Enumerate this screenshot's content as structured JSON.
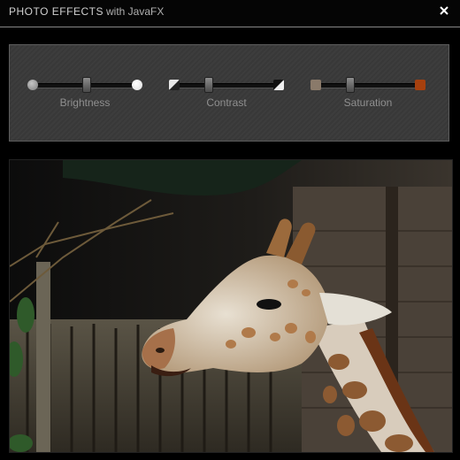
{
  "window": {
    "title": "PHOTO EFFECTS",
    "subtitle": "with JavaFX",
    "close_icon": "close-icon"
  },
  "controls": {
    "sliders": [
      {
        "label": "Brightness",
        "value": 0.5,
        "left_icon": "dark-dot-icon",
        "right_icon": "bright-dot-icon"
      },
      {
        "label": "Contrast",
        "value": 0.3,
        "left_icon": "low-contrast-icon",
        "right_icon": "high-contrast-icon"
      },
      {
        "label": "Saturation",
        "value": 0.3,
        "left_icon": "desaturated-swatch-icon",
        "right_icon": "saturated-swatch-icon"
      }
    ]
  },
  "photo": {
    "subject": "giraffe",
    "icon": "photo-canvas"
  },
  "colors": {
    "background": "#000000",
    "panel": "#3b3b3b",
    "label": "#8f8f8f",
    "saturation_accent": "#a6400e"
  }
}
